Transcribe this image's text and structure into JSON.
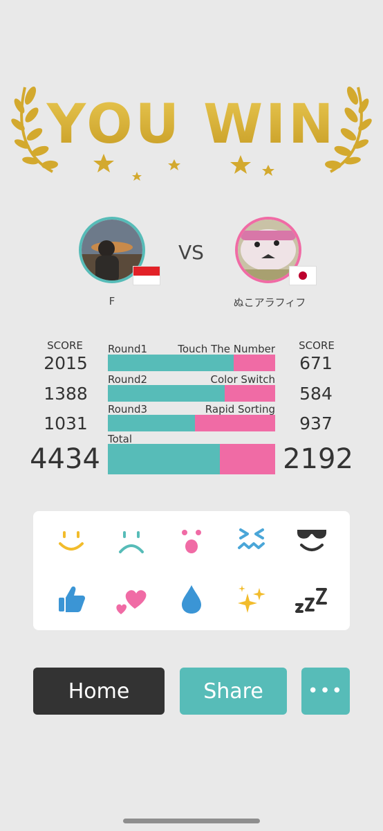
{
  "header": {
    "title": "YOU WIN"
  },
  "match": {
    "vs_label": "VS",
    "player1": {
      "name": "F",
      "flag": "indonesia-flag"
    },
    "player2": {
      "name": "ぬこアラフィフ",
      "flag": "japan-flag"
    }
  },
  "scoreboard": {
    "score_header": "SCORE",
    "rounds": [
      {
        "label": "Round1",
        "game": "Touch The Number",
        "p1_score": "2015",
        "p2_score": "671",
        "p1_share": 0.75
      },
      {
        "label": "Round2",
        "game": "Color Switch",
        "p1_score": "1388",
        "p2_score": "584",
        "p1_share": 0.7
      },
      {
        "label": "Round3",
        "game": "Rapid Sorting",
        "p1_score": "1031",
        "p2_score": "937",
        "p1_share": 0.52
      }
    ],
    "total": {
      "label": "Total",
      "p1_score": "4434",
      "p2_score": "2192",
      "p1_share": 0.67
    }
  },
  "reactions": {
    "row1": [
      "smile-emoji-icon",
      "sad-emoji-icon",
      "surprised-emoji-icon",
      "squint-emoji-icon",
      "sunglasses-emoji-icon"
    ],
    "row2": [
      "thumbs-up-icon",
      "hearts-icon",
      "droplet-icon",
      "sparkles-icon",
      "zzz-icon"
    ]
  },
  "actions": {
    "home_label": "Home",
    "share_label": "Share",
    "more_label": "•••"
  },
  "colors": {
    "teal": "#57bcb8",
    "pink": "#f06ba5",
    "gold": "#d8b43a",
    "dark": "#333333"
  }
}
